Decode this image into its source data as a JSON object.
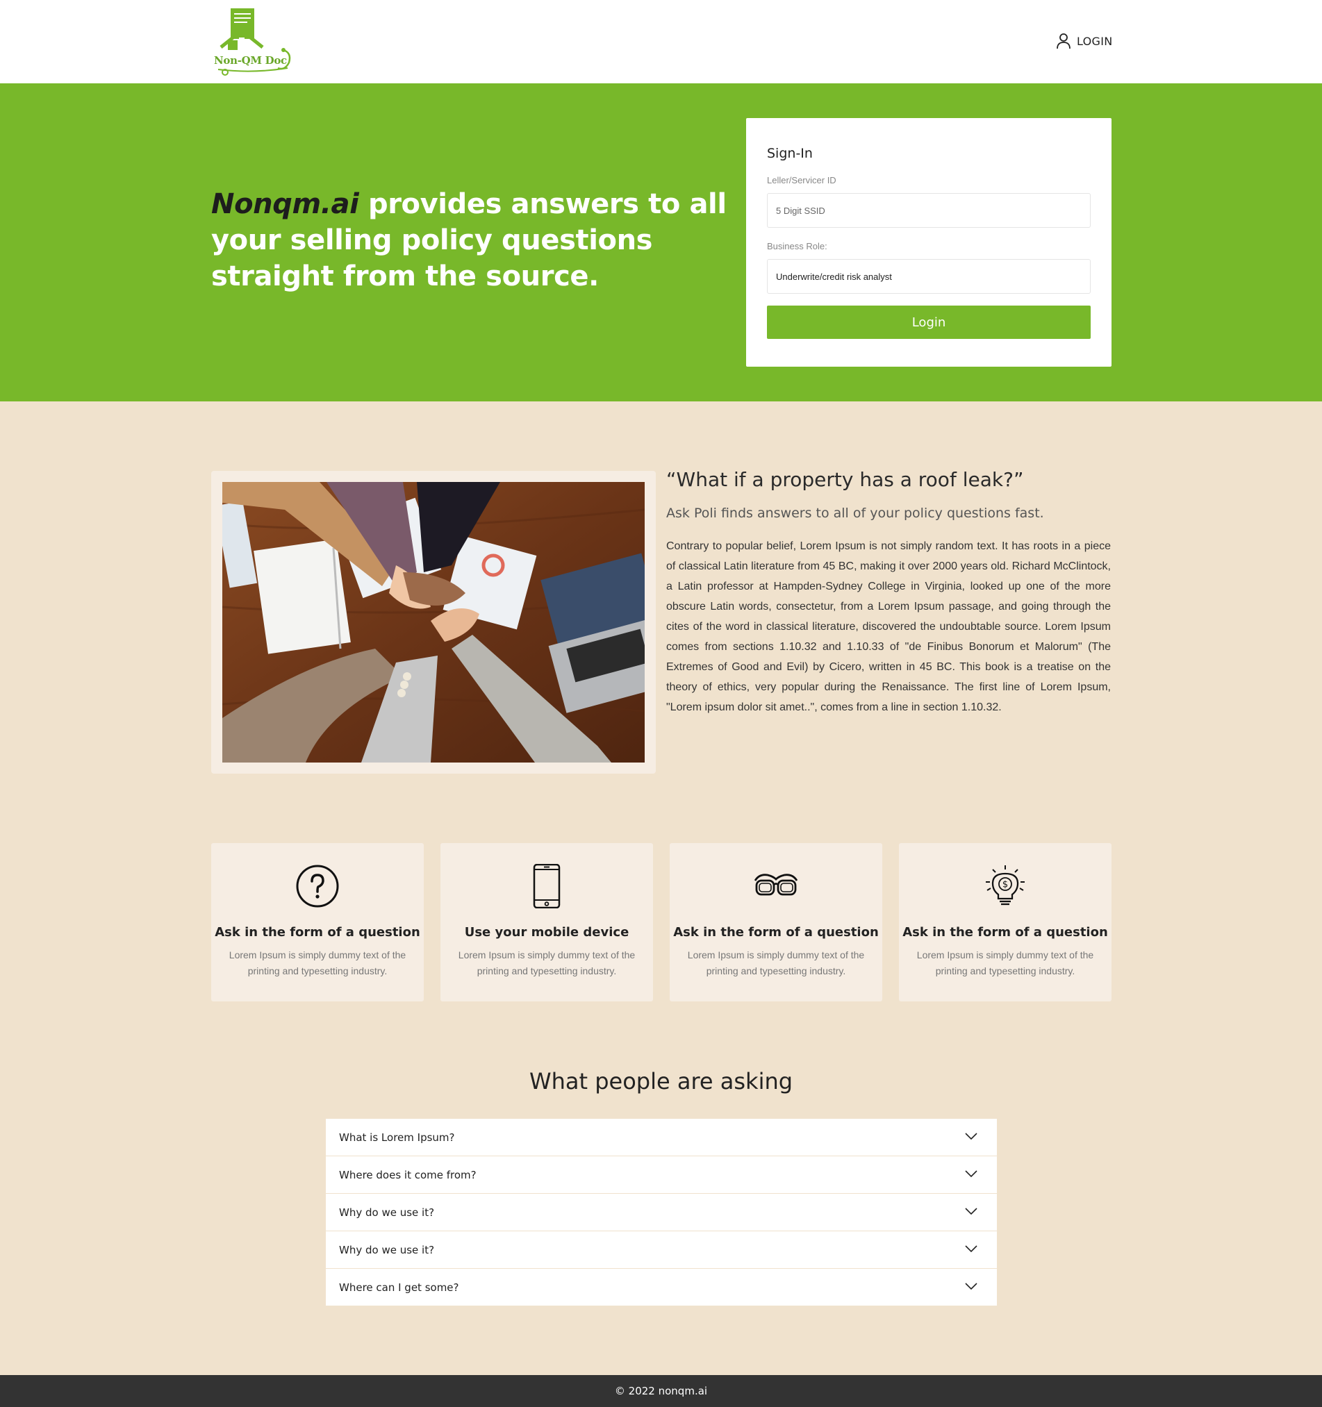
{
  "header": {
    "logo_text": "Non-QM Doc",
    "login_label": "LOGIN"
  },
  "hero": {
    "title_brand": "Nonqm.ai",
    "title_rest": " provides answers to all your selling policy questions straight from the source.",
    "accent_color": "#78b82a"
  },
  "signin": {
    "title": "Sign-In",
    "id_label": "Leller/Servicer ID",
    "id_placeholder": "5 Digit SSID",
    "id_value": "",
    "role_label": "Business Role:",
    "role_value": "Underwrite/credit risk analyst",
    "button_label": "Login"
  },
  "about": {
    "heading": "“What if a property has a roof leak?”",
    "subheading": "Ask Poli finds answers to all of your policy questions fast.",
    "body": "Contrary to popular belief, Lorem Ipsum is not simply random text. It has roots in a piece of classical Latin literature from 45 BC, making it over 2000 years old. Richard McClintock, a Latin professor at Hampden-Sydney College in Virginia, looked up one of the more obscure Latin words, consectetur, from a Lorem Ipsum passage, and going through the cites of the word in classical literature, discovered the undoubtable source. Lorem Ipsum comes from sections 1.10.32 and 1.10.33 of \"de Finibus Bonorum et Malorum\" (The Extremes of Good and Evil) by Cicero, written in 45 BC. This book is a treatise on the theory of ethics, very popular during the Renaissance. The first line of Lorem Ipsum, \"Lorem ipsum dolor sit amet..\", comes from a line in section 1.10.32."
  },
  "features": [
    {
      "icon": "question-circle-icon",
      "title": "Ask in the form of a question",
      "text": "Lorem Ipsum is simply dummy text of the printing and typesetting industry."
    },
    {
      "icon": "mobile-phone-icon",
      "title": "Use your mobile device",
      "text": "Lorem Ipsum is simply dummy text of the printing and typesetting industry."
    },
    {
      "icon": "glasses-icon",
      "title": "Ask in the form of a question",
      "text": "Lorem Ipsum is simply dummy text of the printing and typesetting industry."
    },
    {
      "icon": "lightbulb-dollar-icon",
      "title": "Ask in the form of a question",
      "text": "Lorem Ipsum is simply dummy text of the printing and typesetting industry."
    }
  ],
  "faq": {
    "title": "What people are asking",
    "items": [
      {
        "question": "What is Lorem Ipsum?"
      },
      {
        "question": "Where does it come from?"
      },
      {
        "question": "Why do we use it?"
      },
      {
        "question": "Why do we use it?"
      },
      {
        "question": "Where can I get some?"
      }
    ]
  },
  "footer": {
    "text": "© 2022 nonqm.ai"
  }
}
